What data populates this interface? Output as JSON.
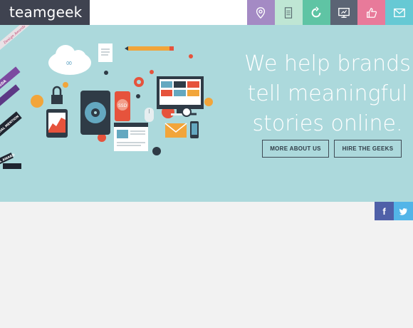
{
  "brand": {
    "logo_text": "teamgeek"
  },
  "nav": {
    "items": [
      {
        "icon": "location-pin-icon",
        "color": "#a48ac4"
      },
      {
        "icon": "document-icon",
        "color": "#bfe6d4"
      },
      {
        "icon": "refresh-icon",
        "color": "#5fc4a4"
      },
      {
        "icon": "monitor-icon",
        "color": "#5b6474"
      },
      {
        "icon": "thumbs-up-icon",
        "color": "#e87a9a"
      },
      {
        "icon": "mail-icon",
        "color": "#66c9d4"
      }
    ]
  },
  "hero": {
    "tagline_line1": "We help brands",
    "tagline_line2": "tell meaningful",
    "tagline_line3": "stories online.",
    "button_about": "MORE ABOUT US",
    "button_hire": "HIRE THE GEEKS",
    "illustration_ssd_label": "SSD"
  },
  "ribbons": {
    "labels": [
      "Design Awards",
      "CSSDA",
      "SPECIAL MENTION",
      "OPL AWARD"
    ]
  },
  "social": {
    "facebook": "f",
    "twitter": "t"
  },
  "colors": {
    "hero_bg": "#acd9dc",
    "page_bg": "#f2f2f2",
    "logo_bg": "#3f4350"
  }
}
